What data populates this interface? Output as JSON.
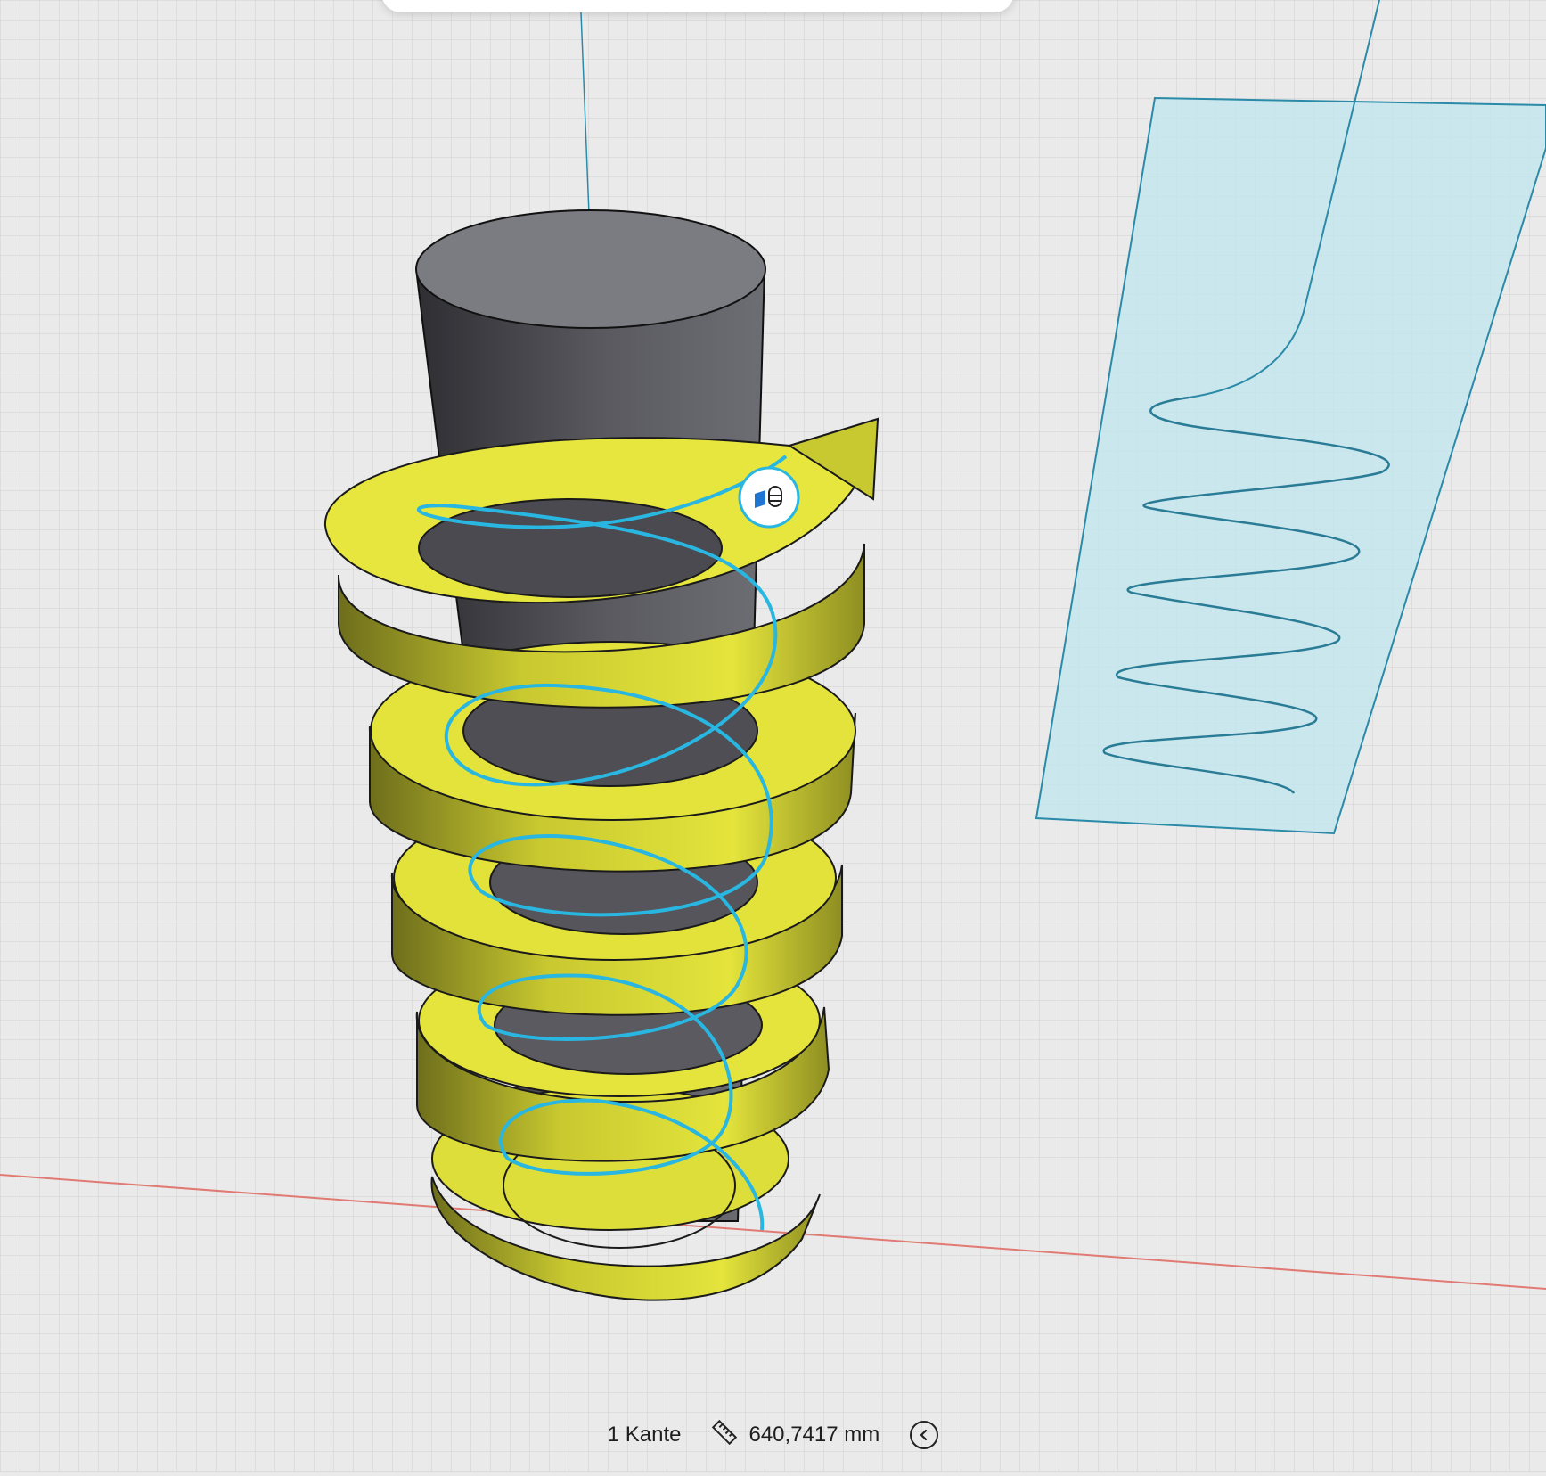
{
  "status_bar": {
    "selection_count": "1 Kante",
    "measure_icon": "ruler-icon",
    "measurement": "640,7417 mm",
    "collapse_icon": "chevron-left-icon"
  },
  "viewport": {
    "model_colors": {
      "spring": "#d8d83a",
      "cylinder": "#5a5a60",
      "selected_edge": "#29b6e0",
      "construction_plane": "#bfe6ee",
      "axis_x": "#e07a72",
      "axis_lines": "#2a8aa8"
    },
    "floating_badge_icon": "selection-filter-icon"
  }
}
